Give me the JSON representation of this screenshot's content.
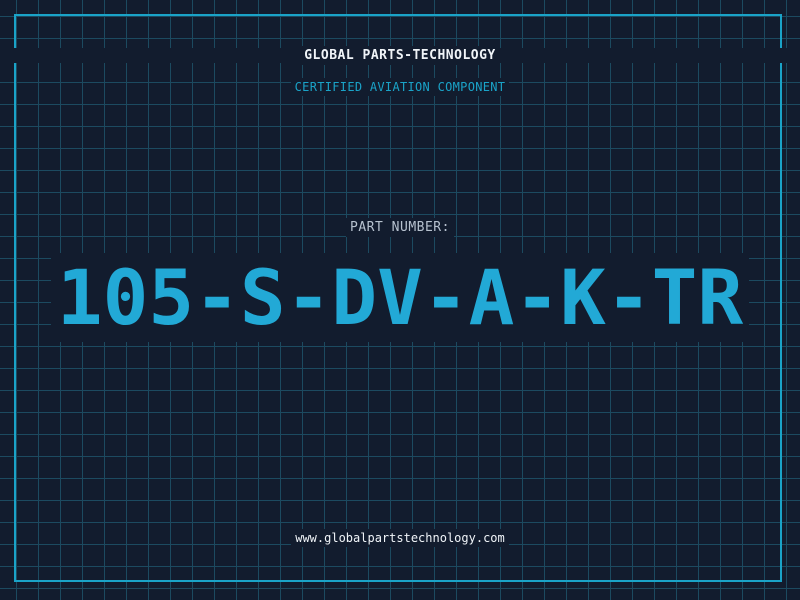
{
  "header": {
    "company": "GLOBAL PARTS-TECHNOLOGY",
    "subtitle": "CERTIFIED AVIATION COMPONENT"
  },
  "part": {
    "label": "PART NUMBER:",
    "number": "105-S-DV-A-K-TR"
  },
  "footer": {
    "website": "www.globalpartstechnology.com"
  },
  "colors": {
    "background": "#121c2e",
    "grid": "#1c4a60",
    "accent": "#1aa3c8",
    "text": "#f0f4f8"
  }
}
